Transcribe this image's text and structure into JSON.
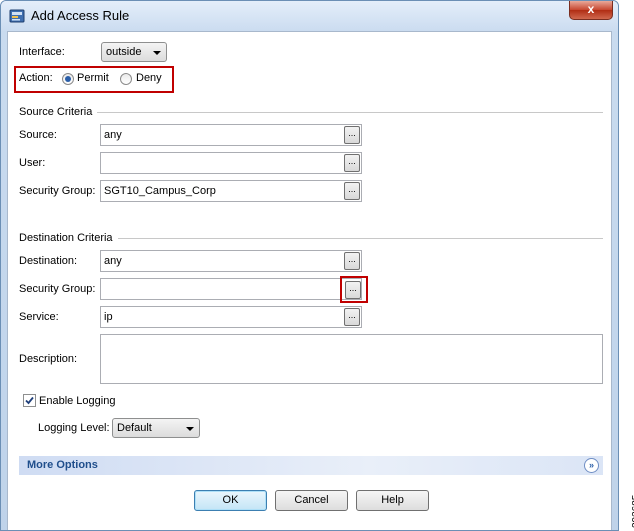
{
  "window": {
    "title": "Add Access Rule",
    "close_label": "x"
  },
  "interface": {
    "label": "Interface:",
    "value": "outside"
  },
  "action": {
    "label": "Action:",
    "permit_label": "Permit",
    "deny_label": "Deny",
    "selected": "Permit"
  },
  "source": {
    "heading": "Source Criteria",
    "source_label": "Source:",
    "source_value": "any",
    "user_label": "User:",
    "user_value": "",
    "security_group_label": "Security Group:",
    "security_group_value": "SGT10_Campus_Corp"
  },
  "destination": {
    "heading": "Destination Criteria",
    "destination_label": "Destination:",
    "destination_value": "any",
    "security_group_label": "Security Group:",
    "security_group_value": "",
    "service_label": "Service:",
    "service_value": "ip"
  },
  "description": {
    "label": "Description:",
    "value": ""
  },
  "logging": {
    "enable_label": "Enable Logging",
    "enabled": true,
    "level_label": "Logging Level:",
    "level_value": "Default"
  },
  "more_options": {
    "label": "More Options"
  },
  "buttons": {
    "ok": "OK",
    "cancel": "Cancel",
    "help": "Help"
  },
  "browse_label": "...",
  "watermark": "293685",
  "colors": {
    "highlight": "#c00000",
    "more_options_text": "#1f4e8c"
  }
}
